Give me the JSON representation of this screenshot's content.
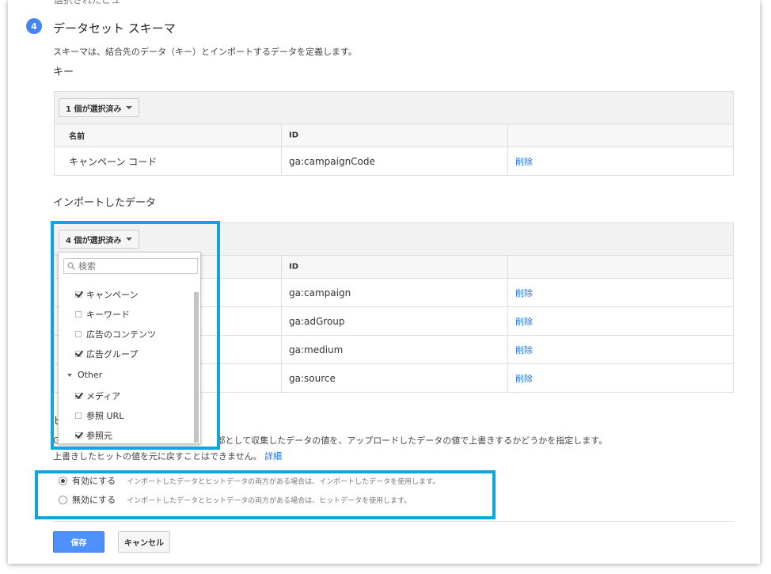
{
  "schema_section": {
    "cut_off_text": "選択されたビュー",
    "step_number": "4",
    "title": "データセット スキーマ",
    "description": "スキーマは、結合先のデータ（キー）とインポートするデータを定義します。",
    "key_label": "キー"
  },
  "key_table": {
    "selected_label": "1 個が選択済み",
    "headers": {
      "name": "名前",
      "id": "ID"
    },
    "rows": [
      {
        "name": "キャンペーン コード",
        "id": "ga:campaignCode",
        "action": "削除"
      }
    ]
  },
  "import_section": {
    "label": "インポートしたデータ"
  },
  "import_table": {
    "selected_label": "4 個が選択済み",
    "headers": {
      "id": "ID"
    },
    "rows": [
      {
        "id": "ga:campaign",
        "action": "削除"
      },
      {
        "id": "ga:adGroup",
        "action": "削除"
      },
      {
        "id": "ga:medium",
        "action": "削除"
      },
      {
        "id": "ga:source",
        "action": "削除"
      }
    ]
  },
  "dropdown": {
    "search_placeholder": "検索",
    "items": [
      {
        "label": "キャンペーン",
        "checked": true
      },
      {
        "label": "キーワード",
        "checked": false
      },
      {
        "label": "広告のコンテンツ",
        "checked": false
      },
      {
        "label": "広告グループ",
        "checked": true
      }
    ],
    "group_label": "Other",
    "group_items": [
      {
        "label": "メディア",
        "checked": true
      },
      {
        "label": "参照 URL",
        "checked": false
      },
      {
        "label": "参照元",
        "checked": true
      }
    ]
  },
  "overwrite_section": {
    "label_visible_part": "ヒ",
    "desc1_prefix": "G",
    "desc1_suffix": "部として収集したデータの値を、アップロードしたデータの値で上書きするかどうかを指定します。",
    "desc2": "上書きしたヒットの値を元に戻すことはできません。",
    "detail_link": "詳細",
    "options": [
      {
        "label": "有効にする",
        "hint": "インポートしたデータとヒットデータの両方がある場合は、インポートしたデータを使用します。",
        "selected": true
      },
      {
        "label": "無効にする",
        "hint": "インポートしたデータとヒットデータの両方がある場合は、ヒットデータを使用します。",
        "selected": false
      }
    ]
  },
  "actions": {
    "save": "保存",
    "cancel": "キャンセル"
  },
  "colors": {
    "accent": "#4285f4",
    "link": "#1a73e8",
    "highlight": "#0ea5e2"
  }
}
